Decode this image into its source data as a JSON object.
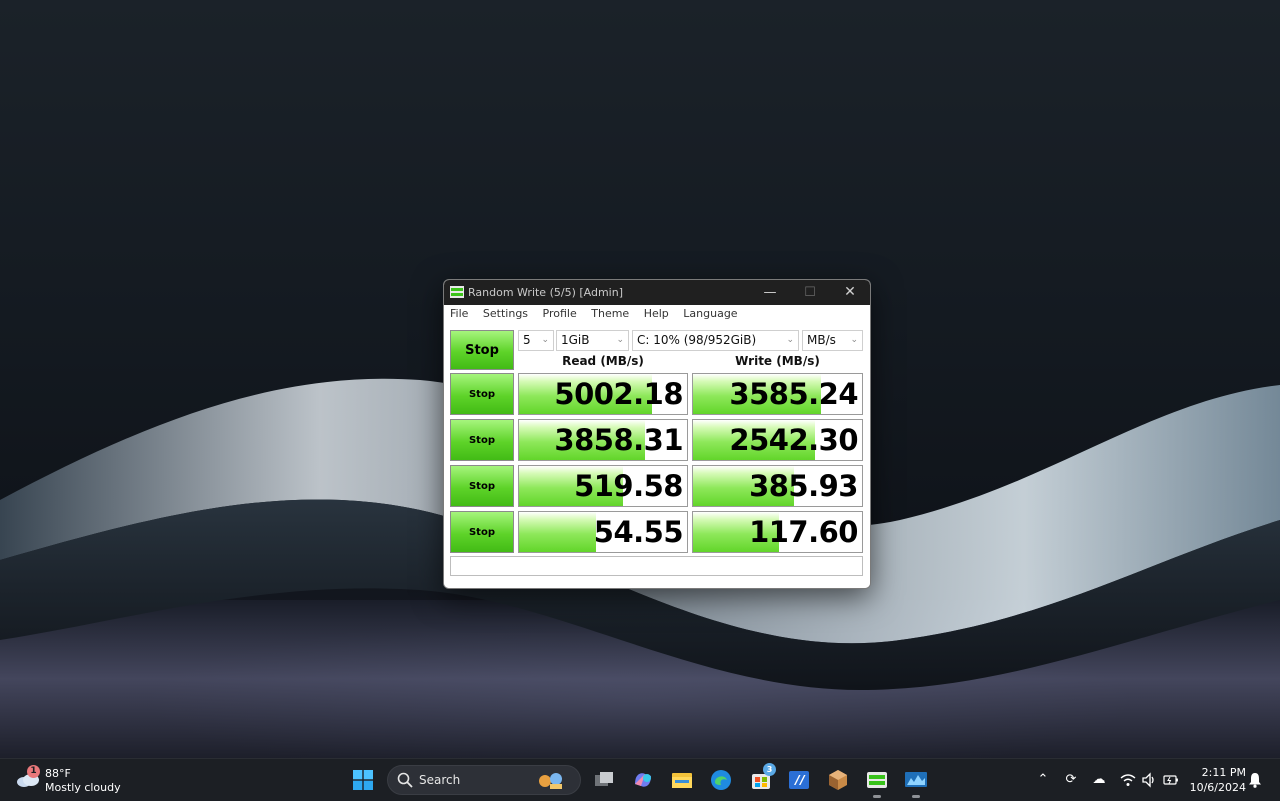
{
  "window": {
    "title": "Random Write (5/5) [Admin]",
    "controls": {
      "minimize": "—",
      "maximize": "☐",
      "close": "✕"
    }
  },
  "menu": [
    "File",
    "Settings",
    "Profile",
    "Theme",
    "Help",
    "Language"
  ],
  "toolbar": {
    "all_button": "Stop",
    "count": "5",
    "size": "1GiB",
    "drive": "C: 10% (98/952GiB)",
    "unit": "MB/s"
  },
  "headers": {
    "read": "Read (MB/s)",
    "write": "Write (MB/s)"
  },
  "rows": [
    {
      "button": "Stop",
      "read": "5002.18",
      "read_fill": 0.79,
      "write": "3585.24",
      "write_fill": 0.76
    },
    {
      "button": "Stop",
      "read": "3858.31",
      "read_fill": 0.75,
      "write": "2542.30",
      "write_fill": 0.72
    },
    {
      "button": "Stop",
      "read": "519.58",
      "read_fill": 0.62,
      "write": "385.93",
      "write_fill": 0.6
    },
    {
      "button": "Stop",
      "read": "54.55",
      "read_fill": 0.46,
      "write": "117.60",
      "write_fill": 0.51
    }
  ],
  "status": "",
  "taskbar": {
    "weather": {
      "badge": "1",
      "temp": "88°F",
      "condition": "Mostly cloudy"
    },
    "search_label": "Search",
    "store_badge": "3",
    "clock": {
      "time": "2:11 PM",
      "date": "10/6/2024"
    }
  },
  "colors": {
    "accent_green": "#5ed329",
    "titlebar": "#202020",
    "taskbar": "#1c1f24"
  }
}
